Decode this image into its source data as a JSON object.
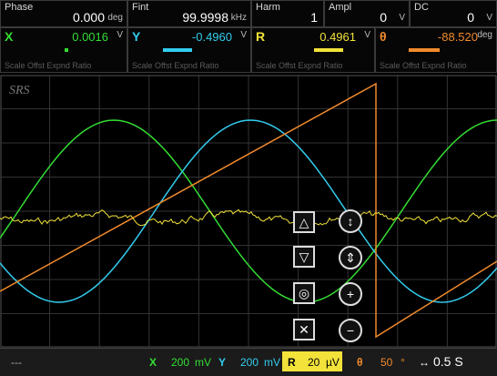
{
  "header": {
    "phase": {
      "label": "Phase",
      "value": "0.000",
      "unit": "deg"
    },
    "fint": {
      "label": "Fint",
      "value": "99.9998",
      "unit": "kHz"
    },
    "harm": {
      "label": "Harm",
      "value": "1"
    },
    "ampl": {
      "label": "Ampl",
      "value": "0",
      "unit": "V"
    },
    "dc": {
      "label": "DC",
      "value": "0",
      "unit": "V"
    }
  },
  "channels": [
    {
      "name": "X",
      "value": "0.0016",
      "unit": "V",
      "color": "#33dd33",
      "sub": "Scale Offst Expnd Ratio"
    },
    {
      "name": "Y",
      "value": "-0.4960",
      "unit": "V",
      "color": "#33ccee",
      "sub": "Scale Offst Expnd Ratio"
    },
    {
      "name": "R",
      "value": "0.4961",
      "unit": "V",
      "color": "#f2e23a",
      "sub": "Scale Offst Expnd Ratio"
    },
    {
      "name": "θ",
      "value": "-88.520",
      "unit": "deg",
      "color": "#f08a2c",
      "sub": "Scale Offst Expnd Ratio"
    }
  ],
  "logo": "SRS",
  "bottom": {
    "dash": "---",
    "x_label": "X",
    "x_scale": "200",
    "x_unit": "mV",
    "y_label": "Y",
    "y_scale": "200",
    "y_unit": "mV",
    "r_label": "R",
    "r_scale": "20",
    "r_unit": "µV",
    "t_label": "θ",
    "t_scale": "50",
    "t_unit": "°",
    "time": "0.5 S"
  },
  "colors": {
    "x": "#33dd33",
    "y": "#33ccee",
    "r": "#f2e23a",
    "theta": "#f08a2c"
  }
}
